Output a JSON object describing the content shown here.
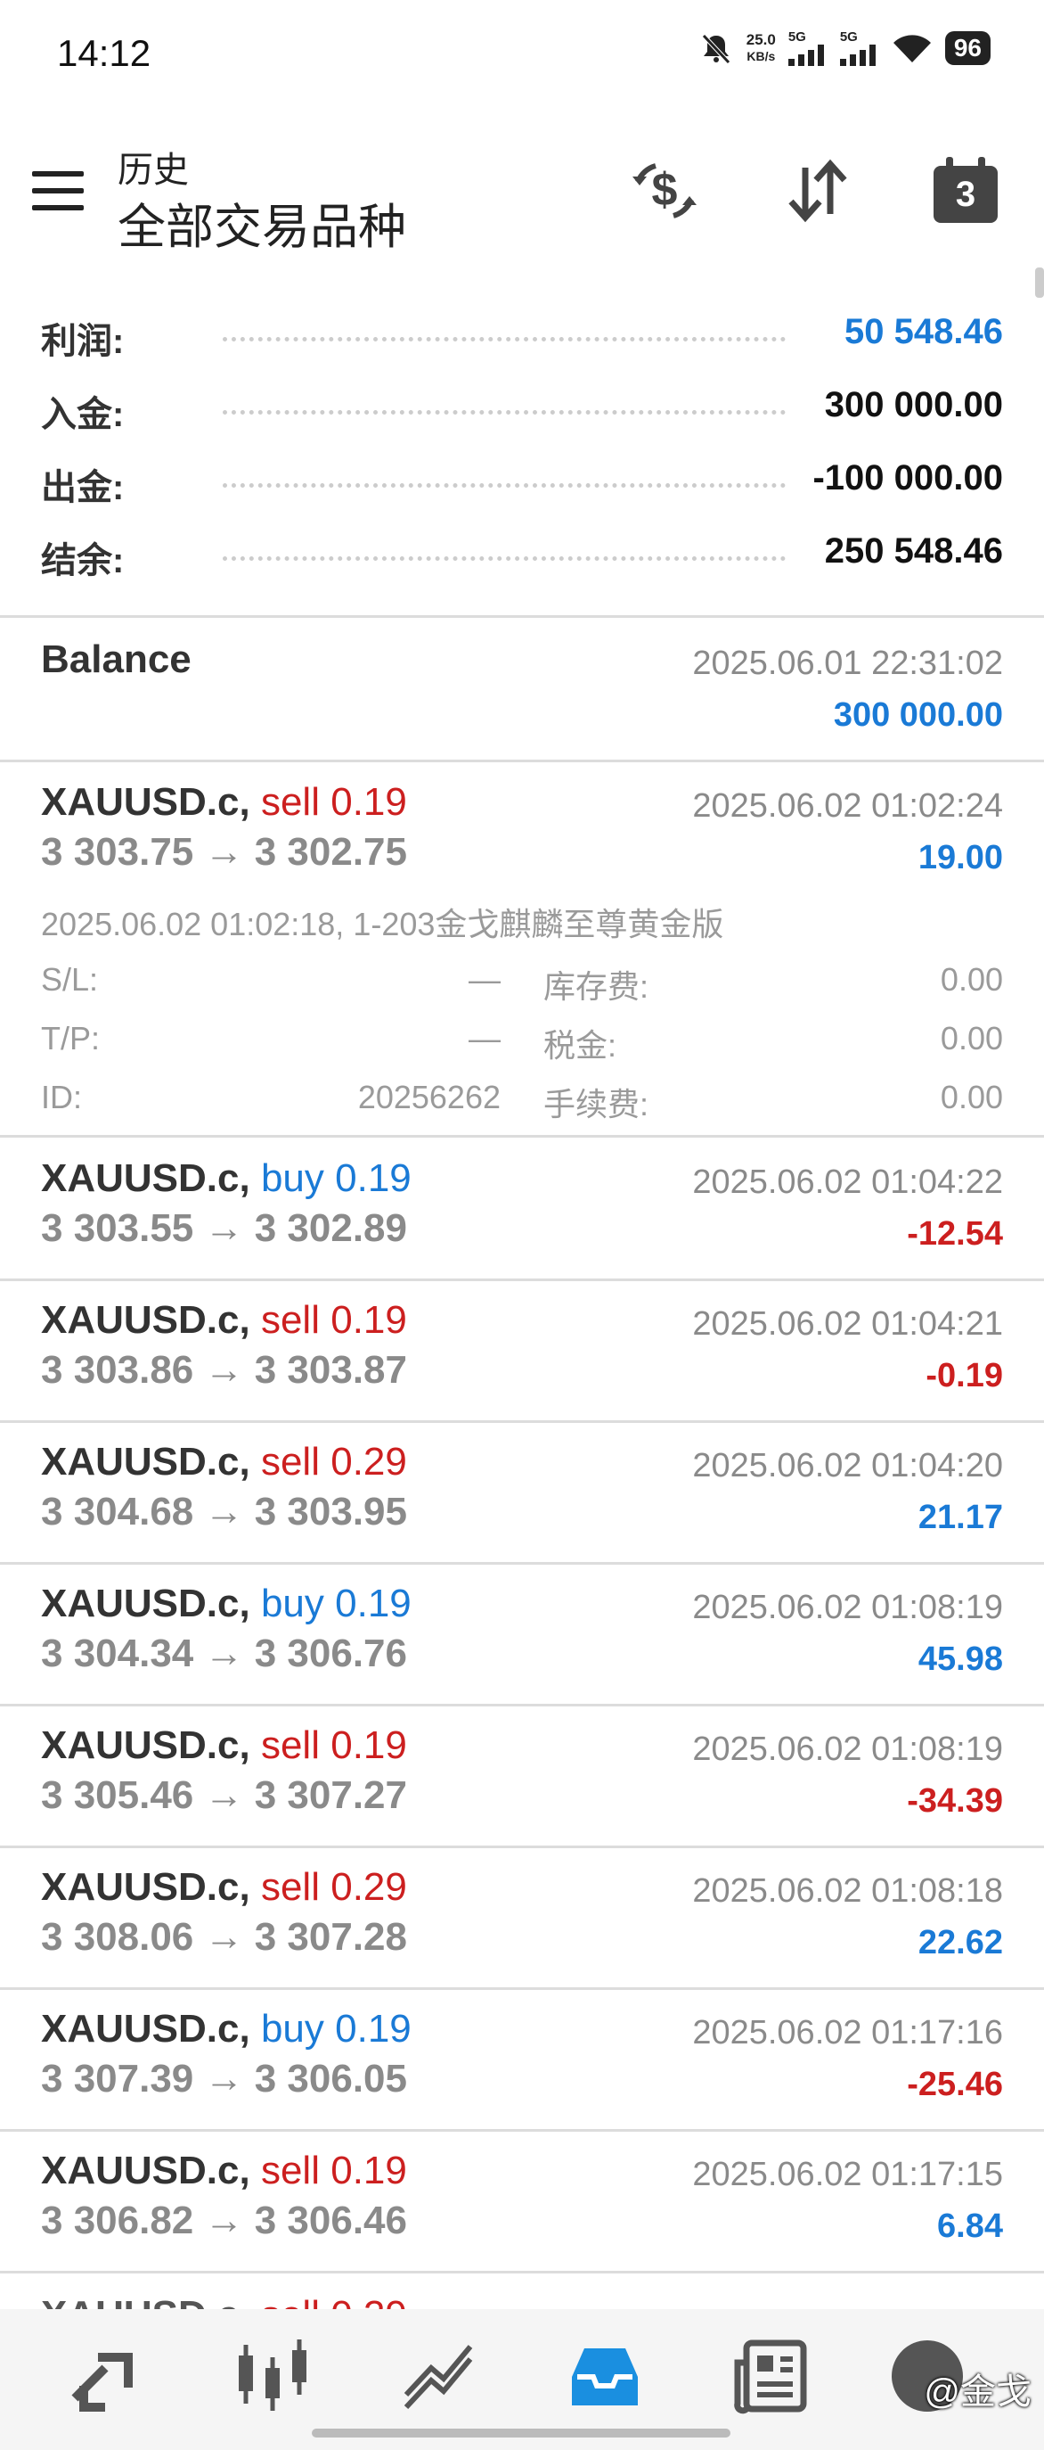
{
  "status_bar": {
    "time": "14:12",
    "net_speed_value": "25.0",
    "net_speed_unit": "KB/s",
    "sim1_label": "5G",
    "sim2_label": "5G",
    "battery": "96"
  },
  "header": {
    "subtitle": "历史",
    "title": "全部交易品种",
    "calendar_day": "3"
  },
  "summary": [
    {
      "label": "利润:",
      "value": "50 548.46"
    },
    {
      "label": "入金:",
      "value": "300 000.00"
    },
    {
      "label": "出金:",
      "value": "-100 000.00"
    },
    {
      "label": "结余:",
      "value": "250 548.46"
    }
  ],
  "balance_entry": {
    "label": "Balance",
    "time": "2025.06.01 22:31:02",
    "amount": "300 000.00"
  },
  "deals": [
    {
      "symbol": "XAUUSD.c,",
      "side": "sell",
      "volume": "0.19",
      "prices": "3 303.75 → 3 302.75",
      "time": "2025.06.02 01:02:24",
      "profit": "19.00"
    },
    {
      "symbol": "XAUUSD.c,",
      "side": "buy",
      "volume": "0.19",
      "prices": "3 303.55 → 3 302.89",
      "time": "2025.06.02 01:04:22",
      "profit": "-12.54"
    },
    {
      "symbol": "XAUUSD.c,",
      "side": "sell",
      "volume": "0.19",
      "prices": "3 303.86 → 3 303.87",
      "time": "2025.06.02 01:04:21",
      "profit": "-0.19"
    },
    {
      "symbol": "XAUUSD.c,",
      "side": "sell",
      "volume": "0.29",
      "prices": "3 304.68 → 3 303.95",
      "time": "2025.06.02 01:04:20",
      "profit": "21.17"
    },
    {
      "symbol": "XAUUSD.c,",
      "side": "buy",
      "volume": "0.19",
      "prices": "3 304.34 → 3 306.76",
      "time": "2025.06.02 01:08:19",
      "profit": "45.98"
    },
    {
      "symbol": "XAUUSD.c,",
      "side": "sell",
      "volume": "0.19",
      "prices": "3 305.46 → 3 307.27",
      "time": "2025.06.02 01:08:19",
      "profit": "-34.39"
    },
    {
      "symbol": "XAUUSD.c,",
      "side": "sell",
      "volume": "0.29",
      "prices": "3 308.06 → 3 307.28",
      "time": "2025.06.02 01:08:18",
      "profit": "22.62"
    },
    {
      "symbol": "XAUUSD.c,",
      "side": "buy",
      "volume": "0.19",
      "prices": "3 307.39 → 3 306.05",
      "time": "2025.06.02 01:17:16",
      "profit": "-25.46"
    },
    {
      "symbol": "XAUUSD.c,",
      "side": "sell",
      "volume": "0.19",
      "prices": "3 306.82 → 3 306.46",
      "time": "2025.06.02 01:17:15",
      "profit": "6.84"
    }
  ],
  "expanded_detail": {
    "open_line": "2025.06.02 01:02:18, 1-203金戈麒麟至尊黄金版",
    "sl_label": "S/L:",
    "sl_value": "—",
    "tp_label": "T/P:",
    "tp_value": "—",
    "id_label": "ID:",
    "id_value": "20256262",
    "swap_label": "库存费:",
    "swap_value": "0.00",
    "tax_label": "税金:",
    "tax_value": "0.00",
    "fee_label": "手续费:",
    "fee_value": "0.00"
  },
  "watermark": "@金戈",
  "colors": {
    "positive": "#1a7ad6",
    "negative": "#cc1f1f",
    "muted": "#8a8a8a",
    "active_tab": "#1a8fe0"
  },
  "bottom_nav_icons": [
    "quotes-icon",
    "chart-icon",
    "trade-icon",
    "history-icon",
    "news-icon",
    "community-icon"
  ]
}
